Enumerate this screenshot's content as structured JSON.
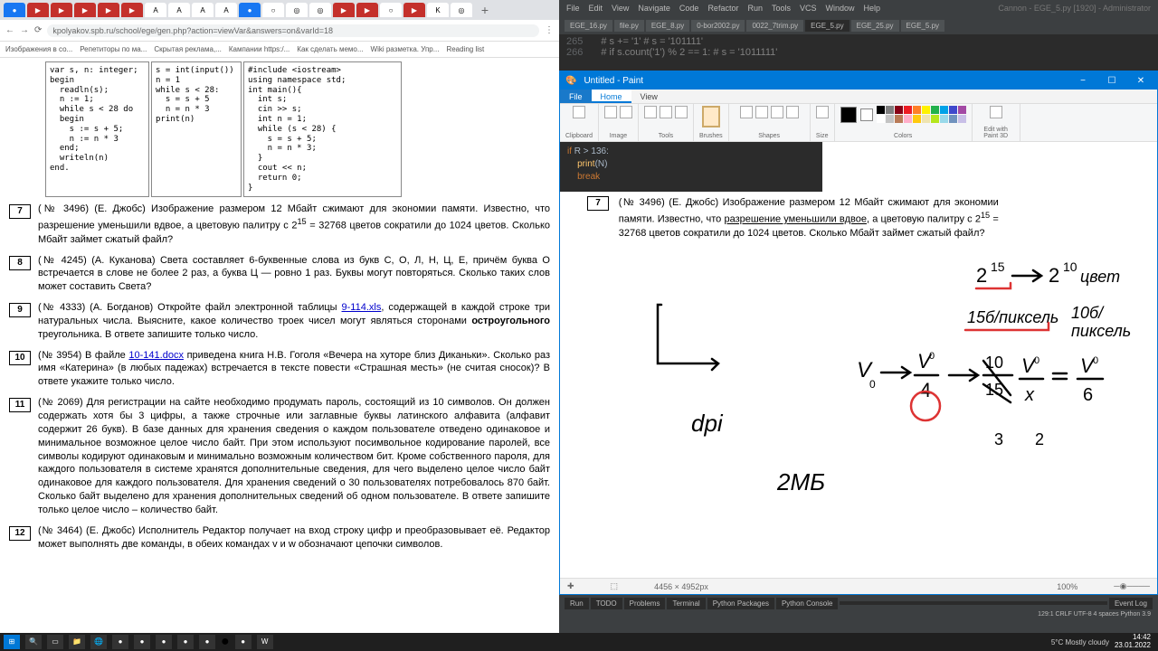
{
  "browser": {
    "url": "kpolyakov.spb.ru/school/ege/gen.php?action=viewVar&answers=on&varId=18",
    "bookmarks": [
      "Изображения в со...",
      "Репетиторы по ма...",
      "Скрытая реклама,...",
      "Кампании https:/...",
      "Как сделать мемо...",
      "Wiki разметка. Упр...",
      "Reading list"
    ],
    "code": {
      "pascal": "var s, n: integer;\nbegin\n  readln(s);\n  n := 1;\n  while s < 28 do\n  begin\n    s := s + 5;\n    n := n * 3\n  end;\n  writeln(n)\nend.",
      "python": "s = int(input())\nn = 1\nwhile s < 28:\n  s = s + 5\n  n = n * 3\nprint(n)",
      "cpp": "#include <iostream>\nusing namespace std;\nint main(){\n  int s;\n  cin >> s;\n  int n = 1;\n  while (s < 28) {\n    s = s + 5;\n    n = n * 3;\n  }\n  cout << n;\n  return 0;\n}"
    },
    "tasks": [
      {
        "n": "7",
        "text_a": "(№ 3496) (Е. Джобс) Изображение размером 12 Мбайт сжимают для экономии памяти. Известно, что разрешение уменьшили вдвое, а цветовую палитру с 2",
        "sup": "15",
        "text_b": " = 32768 цветов сократили до 1024 цветов. Сколько Мбайт займет сжатый файл?"
      },
      {
        "n": "8",
        "text_a": "(№ 4245) (А. Куканова) Света составляет 6-буквенные слова из букв С, О, Л, Н, Ц, Е, причём буква О встречается в слове не более 2 раз, а буква Ц — ровно 1 раз. Буквы могут повторяться. Сколько таких слов может составить Света?"
      },
      {
        "n": "9",
        "text_a": "(№ 4333) (А. Богданов) Откройте файл электронной таблицы ",
        "link": "9-114.xls",
        "text_b": ", содержащей в каждой строке три натуральных числа. Выясните, какое количество троек чисел могут являться сторонами ",
        "bold": "остроугольного",
        "text_c": " треугольника. В ответе запишите только число."
      },
      {
        "n": "10",
        "text_a": "(№ 3954) В файле ",
        "link": "10-141.docx",
        "text_b": " приведена книга Н.В. Гоголя «Вечера на хуторе близ Диканьки». Сколько раз имя «Катерина» (в любых падежах) встречается в тексте повести «Страшная месть» (не считая сносок)? В ответе укажите только число."
      },
      {
        "n": "11",
        "text_a": "(№ 2069) Для регистрации на сайте необходимо продумать пароль, состоящий из 10 символов. Он должен содержать хотя бы 3 цифры, а также строчные или заглавные буквы латинского алфавита (алфавит содержит 26 букв). В базе данных для хранения сведения о каждом пользователе отведено одинаковое и минимальное возможное целое число байт. При этом используют посимвольное кодирование паролей, все символы кодируют одинаковым и минимально возможным количеством бит. Кроме собственного пароля, для каждого пользователя в системе хранятся дополнительные сведения, для чего выделено целое число байт одинаковое для каждого пользователя. Для хранения сведений о 30 пользователях потребовалось 870 байт. Сколько байт выделено для хранения дополнительных сведений об одном пользователе. В ответе запишите только целое число – количество байт."
      },
      {
        "n": "12",
        "text_a": "(№ 3464) (Е. Джобс) Исполнитель Редактор получает на вход строку цифр и преобразовывает её. Редактор может выполнять две команды, в обеих командах v и w обозначают цепочки символов."
      }
    ]
  },
  "ide": {
    "menu": [
      "File",
      "Edit",
      "View",
      "Navigate",
      "Code",
      "Refactor",
      "Run",
      "Tools",
      "VCS",
      "Window",
      "Help"
    ],
    "title": "Cannon - EGE_5.py [1920] - Administrator",
    "tabs": [
      "EGE_16.py",
      "file.py",
      "EGE_8.py",
      "0-bor2002.py",
      "0022_7trim.py",
      "EGE_5.py",
      "EGE_25.py",
      "EGE_5.py"
    ],
    "code_lines": [
      {
        "ln": "265",
        "code": "#             s += '1'  # s = '101111'"
      },
      {
        "ln": "266",
        "code": "#     if s.count('1') % 2 == 1:  # s = '1011111'"
      }
    ],
    "bottom_tabs": [
      "Run",
      "TODO",
      "Problems",
      "Terminal",
      "Python Packages",
      "Python Console"
    ],
    "event_log": "Event Log",
    "status": "129:1  CRLF  UTF-8  4 spaces  Python 3.9"
  },
  "paint": {
    "title": "Untitled - Paint",
    "ribbon_tabs": [
      "File",
      "Home",
      "View"
    ],
    "groups": [
      "Clipboard",
      "Image",
      "Tools",
      "Brushes",
      "Shapes",
      "Size",
      "Colors",
      "Edit with Paint 3D"
    ],
    "canvas_code": {
      "l1": "if R > 136:",
      "l2": "    print(N)",
      "l3": "    break"
    },
    "task": {
      "n": "7",
      "t1": "(№ 3496) (Е. Джобс) Изображение размером 12 Мбайт сжимают для экономии памяти. Известно, что ",
      "u": "разрешение уменьшили вдвое",
      "t2": ", а цветовую палитру с 2",
      "sup": "15",
      "t3": " = 32768 цветов сократили до 1024 цветов. Сколько Мбайт займет сжатый файл?"
    },
    "status_dim": "4456 × 4952px",
    "status_zoom": "100%"
  },
  "taskbar": {
    "weather": "5°C  Mostly cloudy",
    "time": "14:42",
    "date": "23.01.2022"
  },
  "colors": [
    "#000",
    "#7f7f7f",
    "#880015",
    "#ed1c24",
    "#ff7f27",
    "#fff200",
    "#22b14c",
    "#00a2e8",
    "#3f48cc",
    "#a349a4",
    "#fff",
    "#c3c3c3",
    "#b97a57",
    "#ffaec9",
    "#ffc90e",
    "#efe4b0",
    "#b5e61d",
    "#99d9ea",
    "#7092be",
    "#c8bfe7"
  ]
}
